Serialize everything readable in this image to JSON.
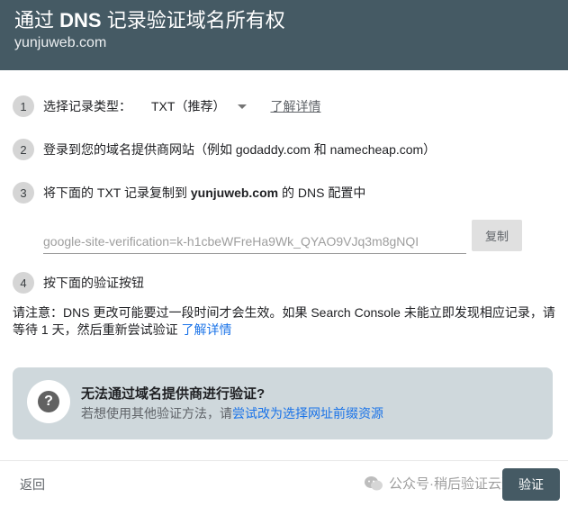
{
  "header": {
    "title_prefix": "通过",
    "title_strong": "DNS",
    "title_suffix": "记录验证域名所有权",
    "domain": "yunjuweb.com"
  },
  "steps": [
    {
      "number": "1",
      "label": "选择记录类型：",
      "record_type": "TXT（推荐）",
      "learn_more": "了解详情"
    },
    {
      "number": "2",
      "text": "登录到您的域名提供商网站（例如 godaddy.com 和 namecheap.com）"
    },
    {
      "number": "3",
      "text_prefix": "将下面的 TXT 记录复制到",
      "domain": "yunjuweb.com",
      "text_suffix": "的 DNS 配置中",
      "verification_value": "google-site-verification=k-h1cbeWFreHa9Wk_QYAO9VJq3m8gNQI",
      "copy_label": "复制"
    },
    {
      "number": "4",
      "text": "按下面的验证按钮"
    }
  ],
  "note": {
    "text": "请注意：DNS 更改可能要过一段时间才会生效。如果 Search Console 未能立即发现相应记录，请等待 1 天，然后重新尝试验证 ",
    "link": "了解详情"
  },
  "alternative": {
    "icon": "help-icon",
    "icon_glyph": "?",
    "title": "无法通过域名提供商进行验证?",
    "subtitle_prefix": "若想使用其他验证方法，请",
    "subtitle_link": "尝试改为选择网址前缀资源"
  },
  "footer": {
    "back_label": "返回",
    "watermark": "公众号·稍后验证云聚建站",
    "verify_label": "验证"
  },
  "colors": {
    "header_bg": "#455a64",
    "link": "#1a73e8",
    "alt_box_bg": "#cfd8dc",
    "verify_btn_bg": "#455a64"
  }
}
